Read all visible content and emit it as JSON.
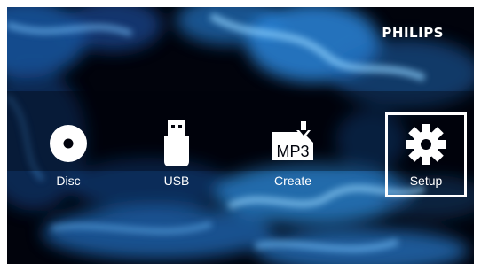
{
  "brand": {
    "name": "PHILIPS"
  },
  "menu": {
    "selected": "Setup",
    "items": [
      {
        "label": "Disc",
        "icon": "disc-icon"
      },
      {
        "label": "USB",
        "icon": "usb-drive-icon"
      },
      {
        "label": "Create",
        "icon": "mp3-create-icon",
        "icon_text": "MP3"
      },
      {
        "label": "Setup",
        "icon": "gear-icon",
        "selected": true
      }
    ]
  },
  "colors": {
    "background": "#01030c",
    "glow": "#2f8fe0",
    "text": "#ffffff",
    "selection_border": "#ffffff"
  }
}
